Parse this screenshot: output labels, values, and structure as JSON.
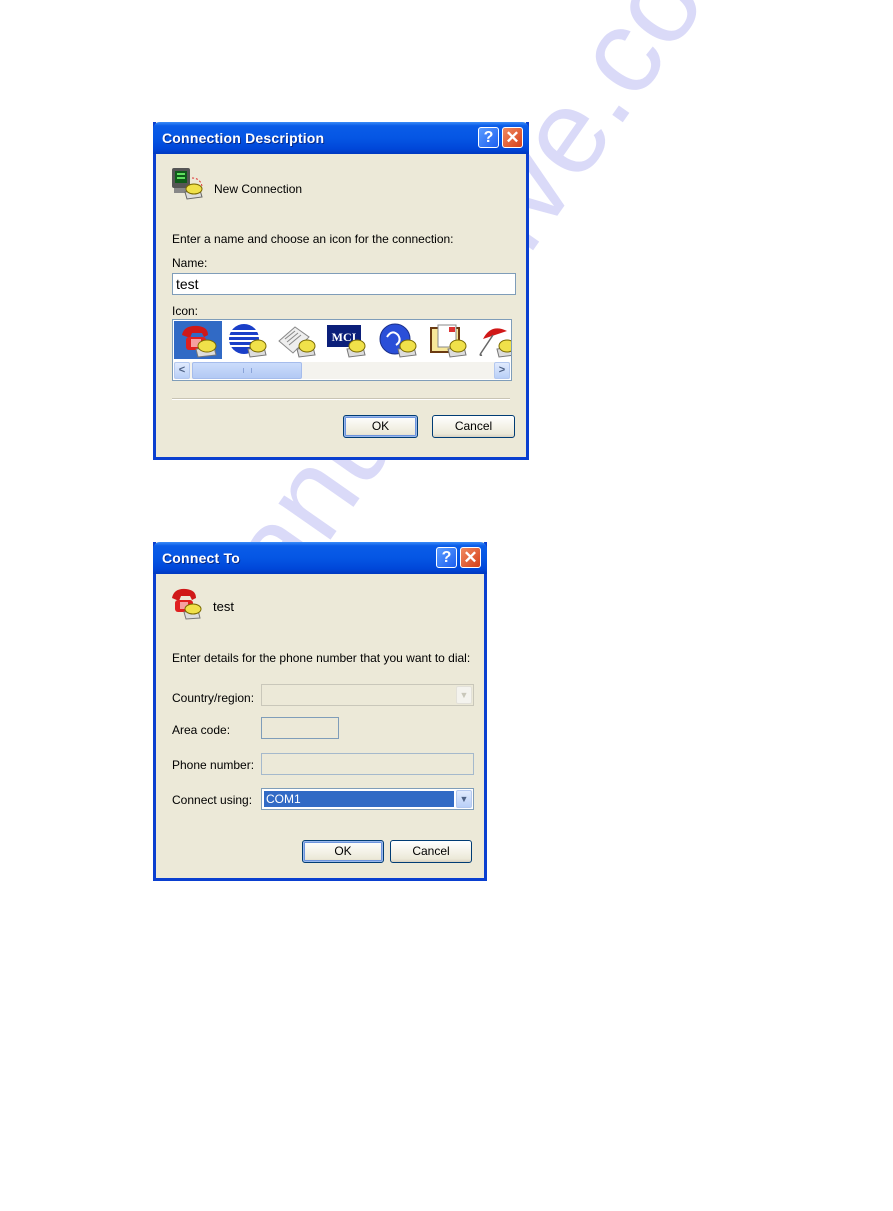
{
  "dialog1": {
    "title": "Connection Description",
    "help_button": "?",
    "close_button": "✕",
    "header_text": "New Connection",
    "prompt": "Enter a name and choose an icon for the connection:",
    "name_label": "Name:",
    "name_value": "test",
    "icon_label": "Icon:",
    "icons": [
      {
        "name": "red-phone",
        "selected": true
      },
      {
        "name": "blue-globe",
        "selected": false
      },
      {
        "name": "newspaper",
        "selected": false
      },
      {
        "name": "mci",
        "selected": false,
        "text": "MCI"
      },
      {
        "name": "ge-globe",
        "selected": false
      },
      {
        "name": "documents",
        "selected": false
      },
      {
        "name": "umbrella",
        "selected": false
      }
    ],
    "scroll_left": "<",
    "scroll_right": ">",
    "ok_label": "OK",
    "cancel_label": "Cancel"
  },
  "dialog2": {
    "title": "Connect To",
    "help_button": "?",
    "close_button": "✕",
    "header_text": "test",
    "prompt": "Enter details for the phone number that you want to dial:",
    "country_label": "Country/region:",
    "country_value": "",
    "area_code_label": "Area code:",
    "area_code_value": "",
    "phone_label": "Phone number:",
    "phone_value": "",
    "connect_using_label": "Connect using:",
    "connect_using_value": "COM1",
    "ok_label": "OK",
    "cancel_label": "Cancel"
  },
  "watermark": "manualshive.com",
  "colors": {
    "title_bar": "#0556e4",
    "dialog_bg": "#ece9d8",
    "selection": "#316ac5",
    "close_btn": "#d6401a"
  }
}
